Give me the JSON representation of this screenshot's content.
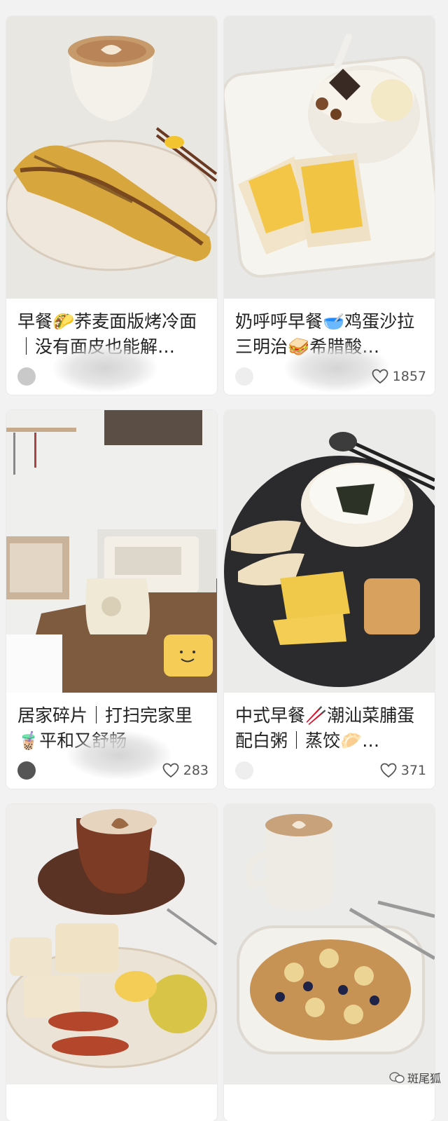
{
  "cards": [
    {
      "title": "早餐🌮荞麦面版烤冷面｜没有面皮也能解…",
      "image": "omelette-roll-breakfast-photo",
      "likes": ""
    },
    {
      "title": "奶呼呼早餐🥣鸡蛋沙拉三明治🥪希腊酸…",
      "image": "egg-sandwich-yogurt-photo",
      "likes": "1857"
    },
    {
      "title": "居家碎片｜打扫完家里🧋平和又舒畅",
      "image": "kitchen-counter-photo",
      "likes": "283"
    },
    {
      "title": "中式早餐🥢潮汕菜脯蛋配白粥｜蒸饺🥟…",
      "image": "chinese-breakfast-congee-photo",
      "likes": "371"
    },
    {
      "title": "",
      "image": "waffle-coffee-breakfast-photo",
      "likes": ""
    },
    {
      "title": "",
      "image": "baked-oats-coffee-photo",
      "likes": ""
    }
  ],
  "watermark": "斑尾狐"
}
